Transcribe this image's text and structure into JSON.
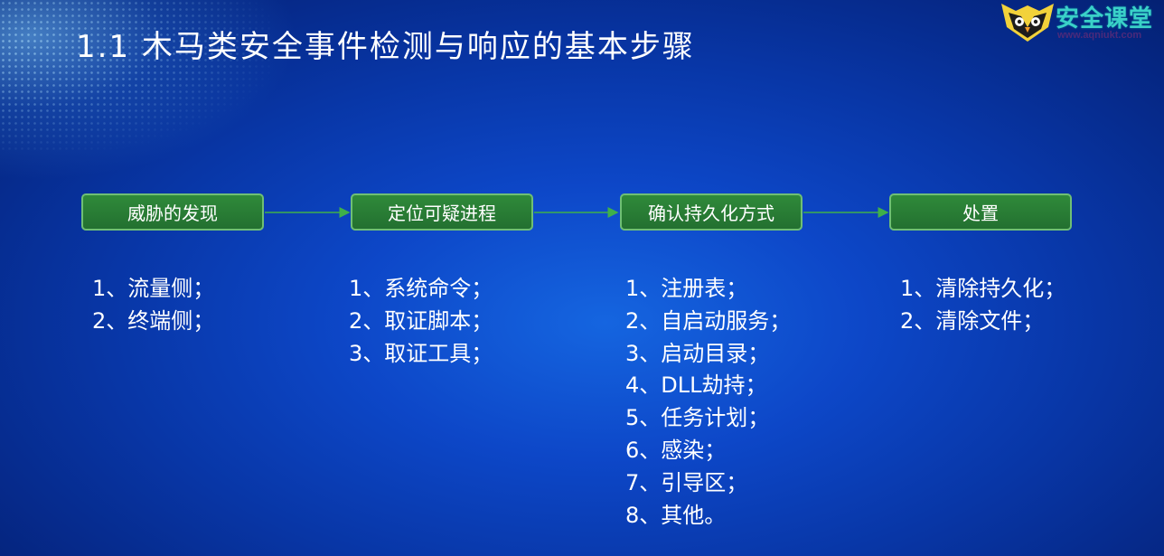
{
  "slide": {
    "title": "1.1  木马类安全事件检测与响应的基本步骤"
  },
  "logo": {
    "text": "安全课堂",
    "url": "www.aqniukt.com"
  },
  "steps": [
    {
      "label": "威胁的发现",
      "items": [
        "1、流量侧；",
        "2、终端侧；"
      ]
    },
    {
      "label": "定位可疑进程",
      "items": [
        "1、系统命令；",
        "2、取证脚本；",
        "3、取证工具；"
      ]
    },
    {
      "label": "确认持久化方式",
      "items": [
        "1、注册表；",
        "2、自启动服务；",
        "3、启动目录；",
        "4、DLL劫持；",
        "5、任务计划；",
        "6、感染；",
        "7、引导区；",
        "8、其他。"
      ]
    },
    {
      "label": "处置",
      "items": [
        "1、清除持久化；",
        "2、清除文件；"
      ]
    }
  ],
  "colors": {
    "background": "#0d47c8",
    "step_box": "#2a7d35",
    "step_border": "#6fbf74",
    "arrow": "#3fb04a"
  }
}
